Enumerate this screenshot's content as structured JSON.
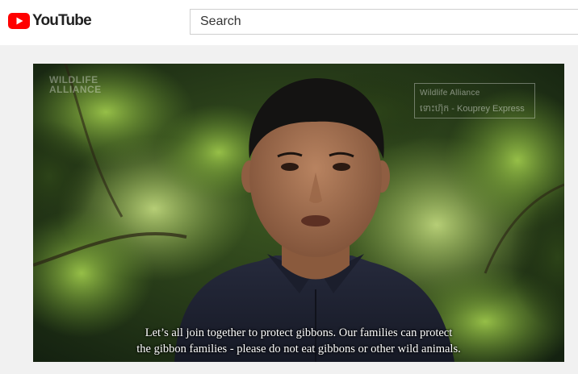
{
  "header": {
    "logo_text": "YouTube",
    "logo_icon": "youtube-play-icon",
    "brand_color": "#ff0000"
  },
  "search": {
    "placeholder": "Search"
  },
  "video": {
    "watermark_left": [
      "WILDLIFE",
      "ALLIANCE"
    ],
    "watermark_right_line1": "Wildlife Alliance",
    "watermark_right_line2": "ទោះហ៊ុក - Kouprey Express",
    "subtitle_line1": "Let’s all join together to protect gibbons. Our families can protect",
    "subtitle_line2": "the gibbon families - please do not eat gibbons or other wild animals."
  }
}
